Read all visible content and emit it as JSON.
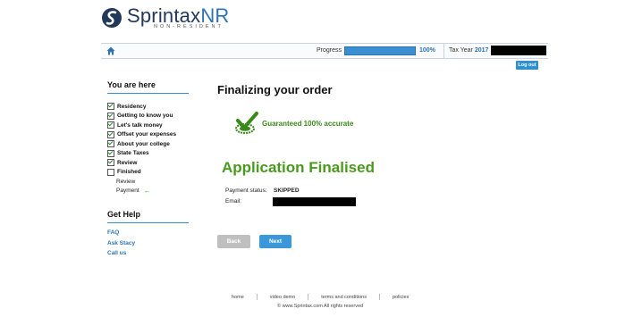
{
  "brand": {
    "name_main": "Sprintax",
    "name_accent": "NR",
    "tagline": "NON-RESIDENT"
  },
  "topbar": {
    "progress_label": "Progress",
    "progress_value": 100,
    "progress_text": "100%",
    "tax_year_label": "Tax Year",
    "tax_year": "2017"
  },
  "logout_label": "Log out",
  "sidebar": {
    "heading": "You are here",
    "steps": [
      {
        "label": "Residency",
        "checked": true
      },
      {
        "label": "Getting to know you",
        "checked": true
      },
      {
        "label": "Let's talk money",
        "checked": true
      },
      {
        "label": "Offset your expenses",
        "checked": true
      },
      {
        "label": "About your college",
        "checked": true
      },
      {
        "label": "State Taxes",
        "checked": true
      },
      {
        "label": "Review",
        "checked": true
      },
      {
        "label": "Finished",
        "checked": false
      }
    ],
    "substeps": [
      "Review",
      "Payment"
    ],
    "help_heading": "Get Help",
    "help_links": [
      "FAQ",
      "Ask Stacy",
      "Call us"
    ]
  },
  "main": {
    "title": "Finalizing your order",
    "guarantee": "Guaranteed 100% accurate",
    "status_heading": "Application Finalised",
    "payment_status_label": "Payment status:",
    "payment_status_value": "SKIPPED",
    "email_label": "Email:"
  },
  "buttons": {
    "back": "Back",
    "next": "Next"
  },
  "footer": {
    "links": [
      "home",
      "video demo",
      "terms and conditions",
      "policies"
    ],
    "copyright": "© www.Sprintax.com All rights reserved"
  },
  "colors": {
    "brand_blue": "#2b73b5",
    "success_green": "#4a9a1e",
    "button_blue": "#3a97d8"
  }
}
